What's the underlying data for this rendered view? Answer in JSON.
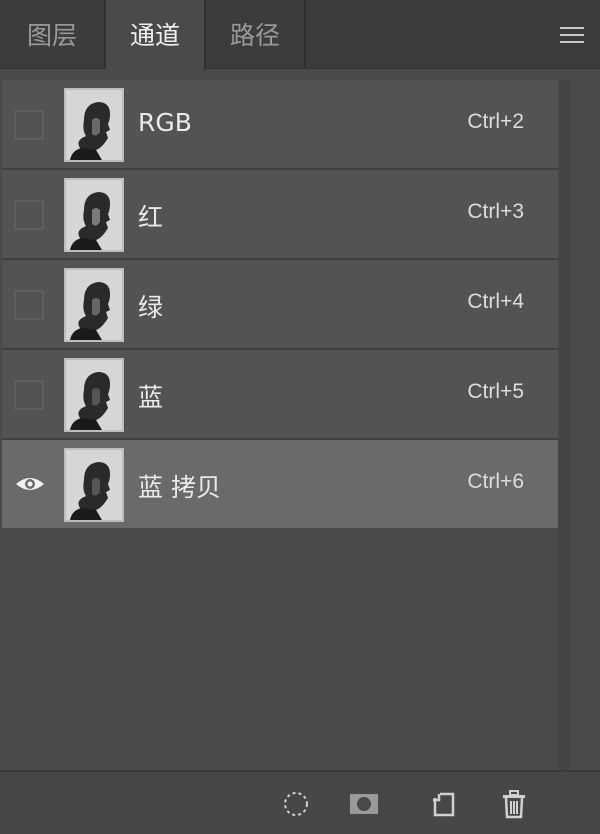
{
  "tabs": [
    {
      "label": "图层",
      "active": false
    },
    {
      "label": "通道",
      "active": true
    },
    {
      "label": "路径",
      "active": false
    }
  ],
  "channels": [
    {
      "name": "RGB",
      "shortcut": "Ctrl+2",
      "visible": false,
      "selected": false
    },
    {
      "name": "红",
      "shortcut": "Ctrl+3",
      "visible": false,
      "selected": false
    },
    {
      "name": "绿",
      "shortcut": "Ctrl+4",
      "visible": false,
      "selected": false
    },
    {
      "name": "蓝",
      "shortcut": "Ctrl+5",
      "visible": false,
      "selected": false
    },
    {
      "name": "蓝 拷贝",
      "shortcut": "Ctrl+6",
      "visible": true,
      "selected": true
    }
  ],
  "toolbar": {
    "icons": [
      "load-selection-icon",
      "save-selection-as-channel-icon",
      "new-channel-icon",
      "delete-channel-icon"
    ]
  },
  "colors": {
    "panel_bg": "#4a4a4a",
    "row_bg": "#535353",
    "selected_row_bg": "#6a6a6a",
    "tabbar_bg": "#3c3c3c"
  }
}
